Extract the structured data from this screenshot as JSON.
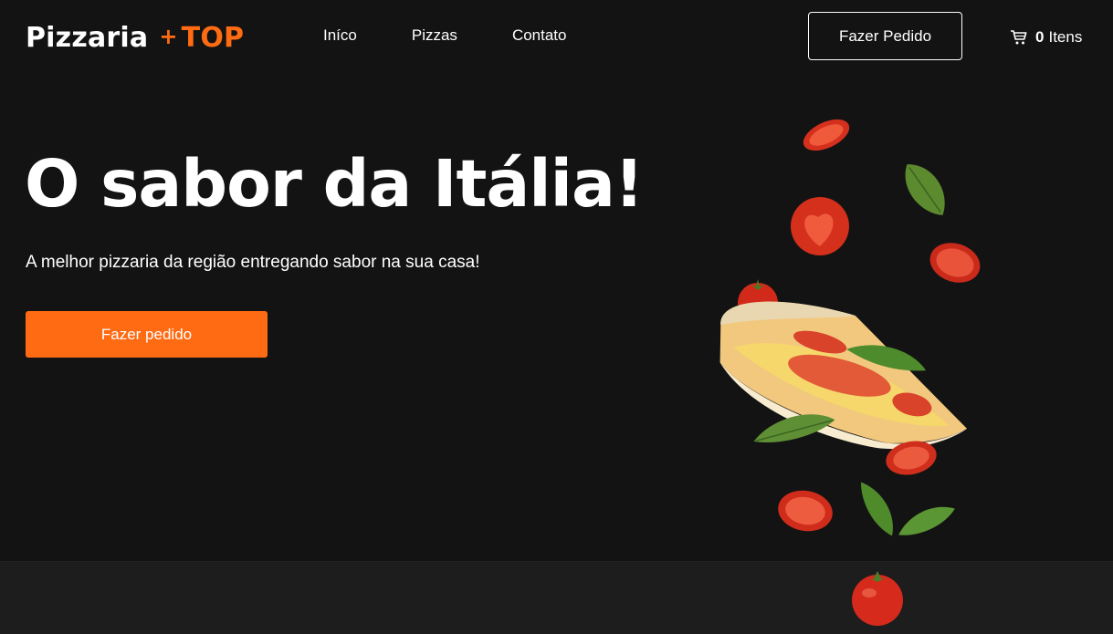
{
  "header": {
    "logo": {
      "brand": "Pizzaria",
      "plus": "+",
      "accent": "TOP"
    },
    "nav": [
      "Iníco",
      "Pizzas",
      "Contato"
    ],
    "order_button": "Fazer Pedido",
    "cart": {
      "count": "0",
      "label": "Itens",
      "icon": "cart-icon"
    }
  },
  "hero": {
    "title": "O sabor da Itália!",
    "subtitle": "A melhor pizzaria da região entregando sabor na sua casa!",
    "cta": "Fazer pedido"
  },
  "colors": {
    "background": "#131313",
    "accent": "#ff6b13",
    "footer": "#1d1d1d"
  }
}
